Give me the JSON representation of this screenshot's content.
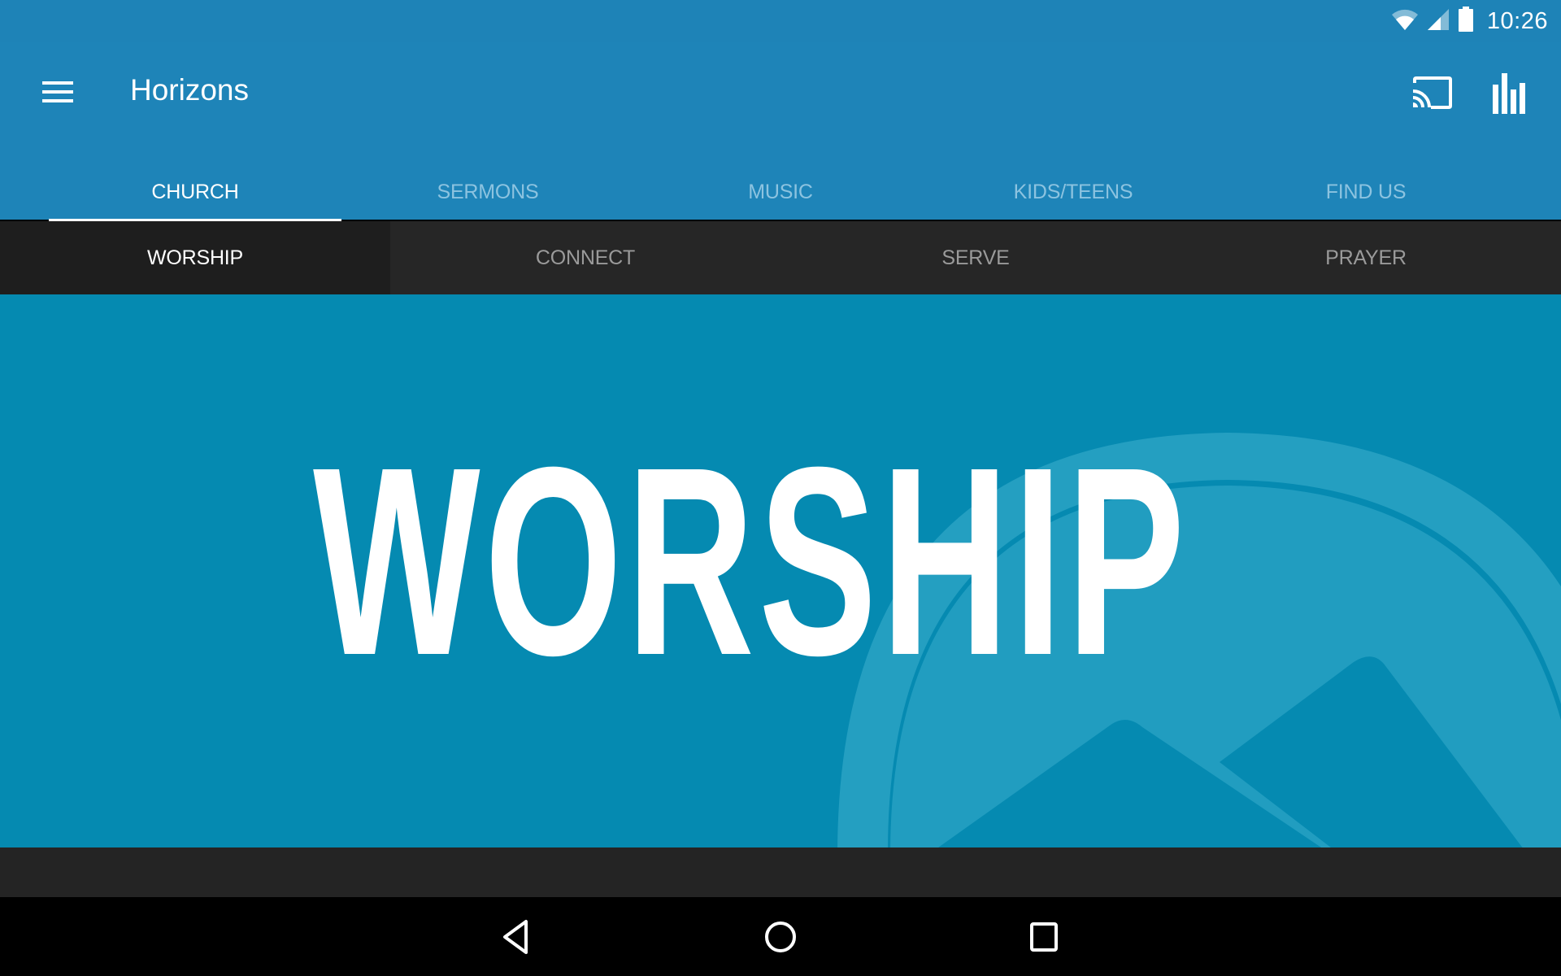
{
  "status_bar": {
    "time": "10:26",
    "icons": [
      "wifi-icon",
      "cell-signal-icon",
      "battery-icon"
    ]
  },
  "app_bar": {
    "title": "Horizons",
    "left_icon": "hamburger-menu-icon",
    "right_icons": [
      "cast-icon",
      "equalizer-icon"
    ]
  },
  "tabs": [
    {
      "label": "CHURCH",
      "active": true
    },
    {
      "label": "SERMONS",
      "active": false
    },
    {
      "label": "MUSIC",
      "active": false
    },
    {
      "label": "KIDS/TEENS",
      "active": false
    },
    {
      "label": "FIND US",
      "active": false
    }
  ],
  "sub_tabs": [
    {
      "label": "WORSHIP",
      "active": true
    },
    {
      "label": "CONNECT",
      "active": false
    },
    {
      "label": "SERVE",
      "active": false
    },
    {
      "label": "PRAYER",
      "active": false
    }
  ],
  "banner": {
    "text": "WORSHIP",
    "background_color": "#058AB1",
    "logo": "horizons-mountain-logo"
  },
  "colors": {
    "primary": "#1E84B8",
    "tab_inactive": "#8CC3E0",
    "subtab_bg": "#262626",
    "subtab_active_bg": "#1E1E1E",
    "subtab_inactive_text": "#9A9A9A"
  },
  "nav_bar": {
    "buttons": [
      "back-icon",
      "home-icon",
      "recents-icon"
    ]
  }
}
